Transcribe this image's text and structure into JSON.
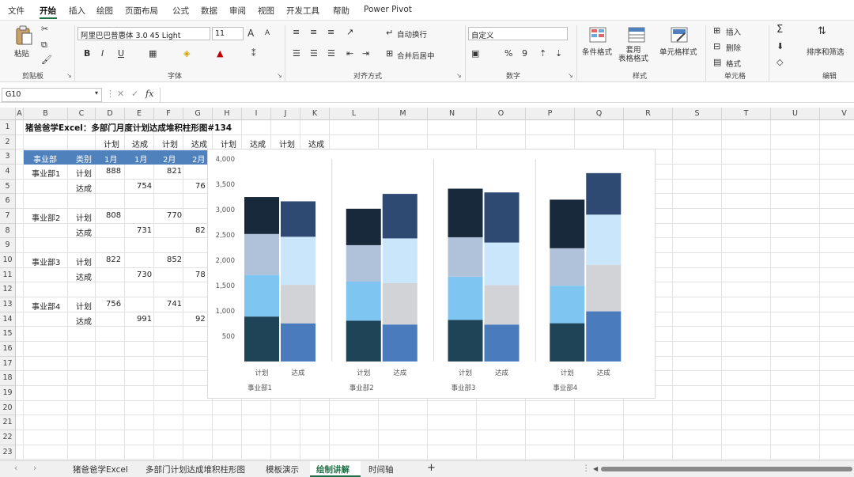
{
  "menu": {
    "items": [
      "文件",
      "开始",
      "插入",
      "绘图",
      "页面布局",
      "公式",
      "数据",
      "审阅",
      "视图",
      "开发工具",
      "帮助",
      "Power Pivot"
    ],
    "active": "开始"
  },
  "ribbon": {
    "clipboard": {
      "paste": "粘贴",
      "group": "剪贴板"
    },
    "font": {
      "name": "阿里巴巴普惠体 3.0 45 Light",
      "size": "11",
      "group": "字体",
      "bold": "B",
      "italic": "I",
      "underline": "U",
      "grow": "A",
      "shrink": "A"
    },
    "alignment": {
      "wrap": "自动换行",
      "merge": "合并后居中",
      "group": "对齐方式"
    },
    "number": {
      "format": "自定义",
      "percent": "%",
      "comma": "9",
      "group": "数字"
    },
    "styles": {
      "conditional": "条件格式",
      "table": "套用\n表格格式",
      "cell": "单元格样式",
      "group": "样式"
    },
    "cells": {
      "insert": "插入",
      "delete": "删除",
      "format": "格式",
      "group": "单元格"
    },
    "editing": {
      "sum": "Σ",
      "sort": "排序和筛选",
      "group": "编辑"
    }
  },
  "formula_bar": {
    "name_box": "G10",
    "fx": "fx",
    "formula": ""
  },
  "columns": [
    "A",
    "B",
    "C",
    "D",
    "E",
    "F",
    "G",
    "H",
    "I",
    "J",
    "K",
    "L",
    "M",
    "N",
    "O",
    "P",
    "Q",
    "R",
    "S",
    "T",
    "U",
    "V"
  ],
  "rows": [
    "1",
    "2",
    "3",
    "4",
    "5",
    "6",
    "7",
    "8",
    "9",
    "10",
    "11",
    "12",
    "13",
    "14",
    "15",
    "16",
    "17",
    "18",
    "19",
    "20",
    "21",
    "22",
    "23"
  ],
  "sheet": {
    "title": "猪爸爸学Excel：多部门月度计划达成堆积柱形图#134",
    "row2": [
      "计划",
      "达成",
      "计划",
      "达成",
      "计划",
      "达成",
      "计划",
      "达成"
    ],
    "header": [
      "事业部",
      "类别",
      "1月",
      "1月",
      "2月",
      "2月"
    ],
    "depts": [
      {
        "name": "事业部1",
        "plan_label": "计划",
        "done_label": "达成",
        "plan1": "888",
        "done1": "754",
        "plan2": "821",
        "done2": "76"
      },
      {
        "name": "事业部2",
        "plan_label": "计划",
        "done_label": "达成",
        "plan1": "808",
        "done1": "731",
        "plan2": "770",
        "done2": "82"
      },
      {
        "name": "事业部3",
        "plan_label": "计划",
        "done_label": "达成",
        "plan1": "822",
        "done1": "730",
        "plan2": "852",
        "done2": "78"
      },
      {
        "name": "事业部4",
        "plan_label": "计划",
        "done_label": "达成",
        "plan1": "756",
        "done1": "991",
        "plan2": "741",
        "done2": "92"
      }
    ]
  },
  "chart_data": {
    "type": "bar",
    "stacked": true,
    "ylim": [
      0,
      4000
    ],
    "yticks": [
      "500",
      "1,000",
      "1,500",
      "2,000",
      "2,500",
      "3,000",
      "3,500",
      "4,000"
    ],
    "ytick_values": [
      500,
      1000,
      1500,
      2000,
      2500,
      3000,
      3500,
      4000
    ],
    "groups": [
      {
        "label": "事业部1",
        "bars": [
          {
            "label": "计划",
            "kind": "plan",
            "segments": [
              888,
              821,
              810,
              730
            ]
          },
          {
            "label": "达成",
            "kind": "done",
            "segments": [
              754,
              760,
              950,
              700
            ]
          }
        ]
      },
      {
        "label": "事业部2",
        "bars": [
          {
            "label": "计划",
            "kind": "plan",
            "segments": [
              808,
              770,
              720,
              720
            ]
          },
          {
            "label": "达成",
            "kind": "done",
            "segments": [
              731,
              820,
              880,
              880
            ]
          }
        ]
      },
      {
        "label": "事业部3",
        "bars": [
          {
            "label": "计划",
            "kind": "plan",
            "segments": [
              822,
              852,
              780,
              960
            ]
          },
          {
            "label": "达成",
            "kind": "done",
            "segments": [
              730,
              780,
              840,
              990
            ]
          }
        ]
      },
      {
        "label": "事业部4",
        "bars": [
          {
            "label": "计划",
            "kind": "plan",
            "segments": [
              756,
              741,
              740,
              960
            ]
          },
          {
            "label": "达成",
            "kind": "done",
            "segments": [
              991,
              920,
              990,
              820
            ]
          }
        ]
      }
    ],
    "colors": {
      "plan": [
        "#1f4357",
        "#7ec5f2",
        "#afc2d9",
        "#17293a"
      ],
      "done": [
        "#4a7bbd",
        "#d1d3d7",
        "#c9e6fb",
        "#2e4a73"
      ]
    }
  },
  "tabs": {
    "items": [
      "猪爸爸学Excel",
      "多部门计划达成堆积柱形图",
      "模板演示",
      "绘制讲解",
      "时间轴"
    ],
    "active": "绘制讲解",
    "add": "+"
  }
}
